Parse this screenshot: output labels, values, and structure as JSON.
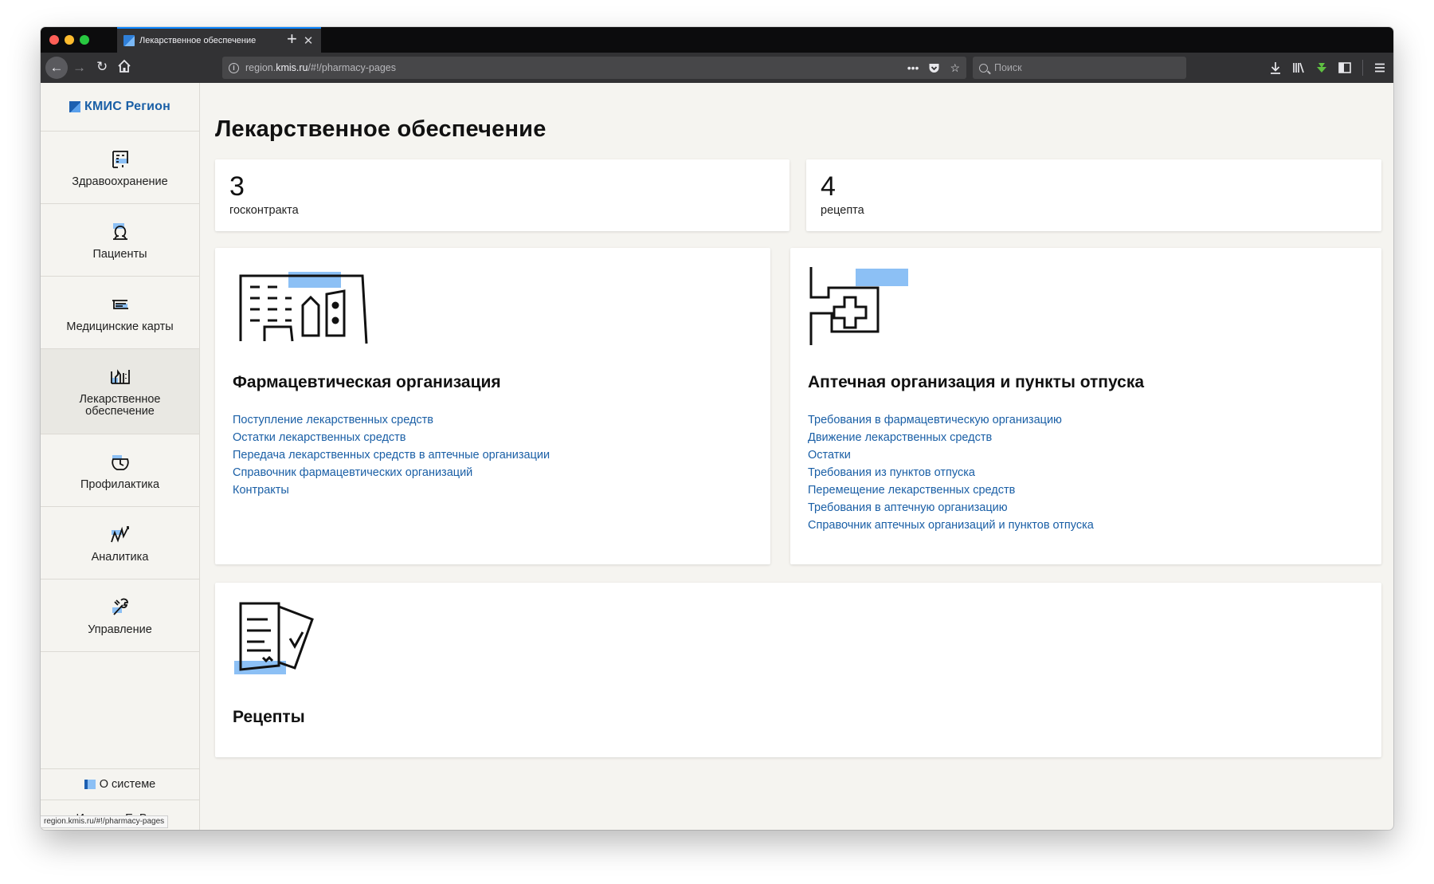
{
  "browser": {
    "tab_title": "Лекарственное обеспечение",
    "tab_close": "✕",
    "new_tab": "+",
    "url_prefix": "region.",
    "url_host": "kmis.ru",
    "url_path": "/#!/pharmacy-pages",
    "search_placeholder": "Поиск",
    "status_url": "region.kmis.ru/#!/pharmacy-pages"
  },
  "app": {
    "logo_text": "КМИС Регион",
    "sidebar": {
      "items": [
        {
          "label": "Здравоохранение",
          "icon": "healthcare-icon",
          "active": false
        },
        {
          "label": "Пациенты",
          "icon": "patients-icon",
          "active": false
        },
        {
          "label": "Медицинские карты",
          "icon": "medical-cards-icon",
          "active": false
        },
        {
          "label": "Лекарственное обеспечение",
          "icon": "drug-supply-icon",
          "active": true
        },
        {
          "label": "Профилактика",
          "icon": "prevention-icon",
          "active": false
        },
        {
          "label": "Аналитика",
          "icon": "analytics-icon",
          "active": false
        },
        {
          "label": "Управление",
          "icon": "management-icon",
          "active": false
        }
      ],
      "about_label": "О системе",
      "user_name": "Иванова Е. В."
    }
  },
  "main": {
    "title": "Лекарственное обеспечение",
    "stats": [
      {
        "value": "3",
        "label": "госконтракта"
      },
      {
        "value": "4",
        "label": "рецепта"
      }
    ],
    "sections": [
      {
        "title": "Фармацевтическая организация",
        "icon": "pharma-org-icon",
        "links": [
          "Поступление лекарственных средств",
          "Остатки лекарственных средств",
          "Передача лекарственных средств в аптечные организации",
          "Справочник фармацевтических организаций",
          "Контракты"
        ]
      },
      {
        "title": "Аптечная организация и пункты отпуска",
        "icon": "pharmacy-icon",
        "links": [
          "Требования в фармацевтическую организацию",
          "Движение лекарственных средств",
          "Остатки",
          "Требования из пунктов отпуска",
          "Перемещение лекарственных средств",
          "Требования в аптечную организацию",
          "Справочник аптечных организаций и пунктов отпуска"
        ]
      },
      {
        "title": "Рецепты",
        "icon": "prescriptions-icon",
        "links": []
      }
    ]
  },
  "colors": {
    "accent": "#1a5fa6",
    "highlight": "#8cc0f5",
    "background": "#f5f4f0"
  }
}
